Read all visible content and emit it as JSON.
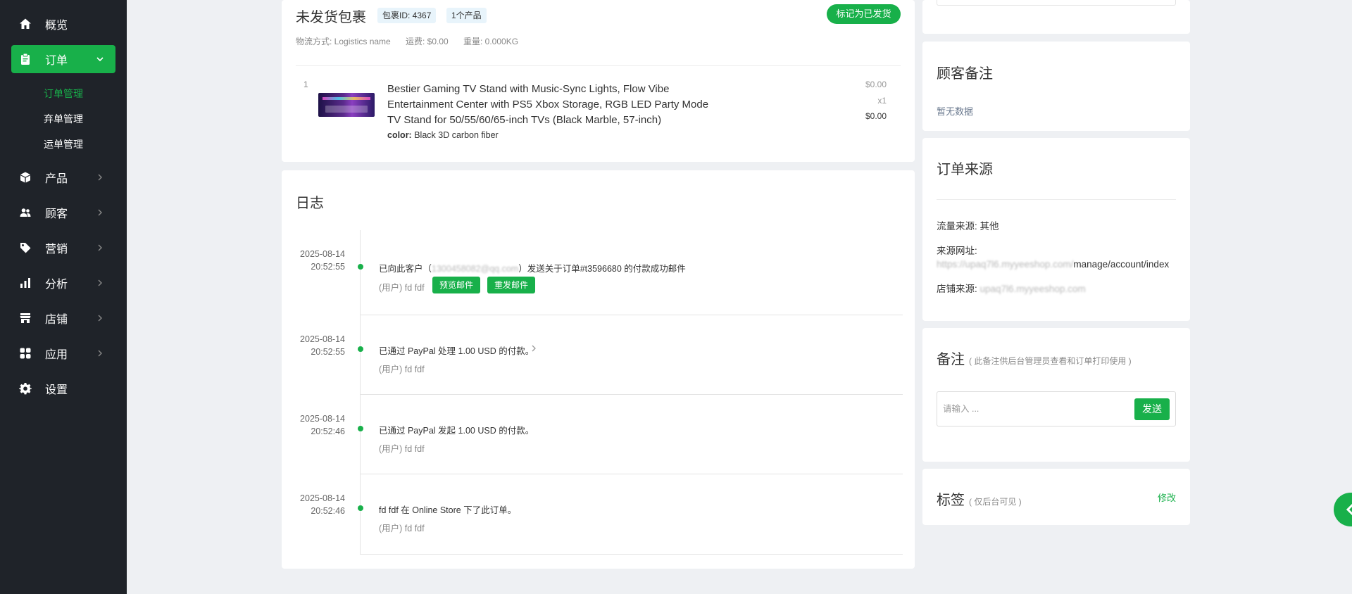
{
  "sidebar": {
    "items": [
      {
        "label": "概览",
        "icon": "home-icon"
      },
      {
        "label": "订单",
        "icon": "clipboard-icon",
        "active": true,
        "expanded": true
      },
      {
        "label": "产品",
        "icon": "box-icon"
      },
      {
        "label": "顾客",
        "icon": "users-icon"
      },
      {
        "label": "营销",
        "icon": "tag-icon"
      },
      {
        "label": "分析",
        "icon": "bar-chart-icon"
      },
      {
        "label": "店铺",
        "icon": "store-icon"
      },
      {
        "label": "应用",
        "icon": "apps-icon"
      },
      {
        "label": "设置",
        "icon": "gear-icon"
      }
    ],
    "sub_items": [
      {
        "label": "订单管理",
        "active": true
      },
      {
        "label": "弃单管理"
      },
      {
        "label": "运单管理"
      }
    ]
  },
  "package": {
    "title": "未发货包裹",
    "id_badge": "包裹ID: 4367",
    "count_badge": "1个产品",
    "mark_shipped_button": "标记为已发货",
    "shipping_method": "物流方式: Logistics name",
    "shipping_fee": "运费: $0.00",
    "weight": "重量: 0.000KG",
    "line_item": {
      "index": "1",
      "title": "Bestier Gaming TV Stand with Music-Sync Lights, Flow Vibe Entertainment Center with PS5 Xbox Storage, RGB LED Party Mode TV Stand for 50/55/60/65-inch TVs (Black Marble, 57-inch)",
      "variant_label": "color:",
      "variant_value": "Black 3D carbon fiber",
      "unit_price": "$0.00",
      "quantity": "x1",
      "total": "$0.00"
    }
  },
  "log": {
    "title": "日志",
    "entries": [
      {
        "date": "2025-08-14",
        "time": "20:52:55",
        "text_prefix": "已向此客户（",
        "email": "1300458082@qq.com",
        "text_suffix": "）发送关于订单#t3596680 的付款成功邮件",
        "user": "(用户) fd fdf",
        "preview_button": "预览邮件",
        "resend_button": "重发邮件"
      },
      {
        "date": "2025-08-14",
        "time": "20:52:55",
        "text": "已通过 PayPal 处理 1.00 USD 的付款。",
        "user": "(用户) fd fdf"
      },
      {
        "date": "2025-08-14",
        "time": "20:52:46",
        "text": "已通过 PayPal 发起 1.00 USD 的付款。",
        "user": "(用户) fd fdf"
      },
      {
        "date": "2025-08-14",
        "time": "20:52:46",
        "text": "fd fdf 在 Online Store 下了此订单。",
        "user": "(用户) fd fdf"
      }
    ]
  },
  "customer_notes": {
    "title": "顾客备注",
    "empty": "暂无数据"
  },
  "order_source": {
    "title": "订单来源",
    "traffic_label": "流量来源: ",
    "traffic_value": "其他",
    "url_label": "来源网址: ",
    "url_blurred": "https://upaq7l6.myyeeshop.com/",
    "url_visible": "manage/account/index",
    "store_label": "店铺来源: ",
    "store_blurred": "upaq7l6.myyeeshop.com"
  },
  "remarks": {
    "title": "备注",
    "subtitle": "( 此备注供后台管理员查看和订单打印使用 )",
    "placeholder": "请输入 ...",
    "send_button": "发送"
  },
  "tags": {
    "title": "标签",
    "subtitle": "( 仅后台可见 )",
    "edit_link": "修改"
  },
  "colors": {
    "accent": "#18b04a",
    "sidebar_bg": "#1f2329",
    "page_bg": "#eef0f3"
  }
}
